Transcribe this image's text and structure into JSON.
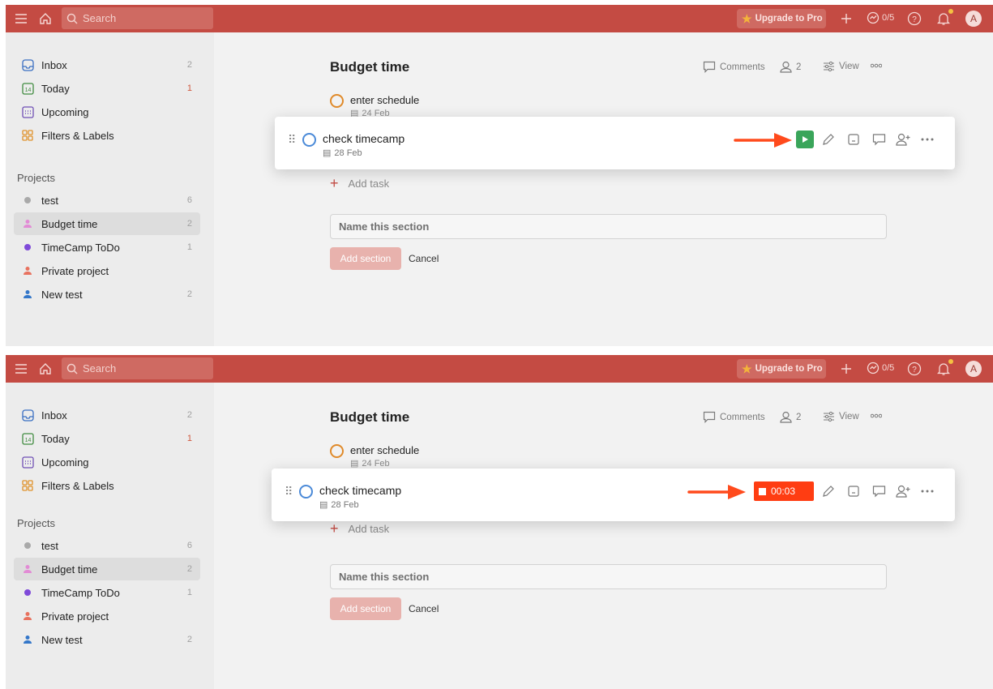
{
  "topbar": {
    "search_placeholder": "Search",
    "upgrade_label": "Upgrade to Pro",
    "karma": "0/5",
    "avatar_initial": "A"
  },
  "sidebar": {
    "items": [
      {
        "label": "Inbox",
        "count": "2"
      },
      {
        "label": "Today",
        "count": "1",
        "today_day": "14"
      },
      {
        "label": "Upcoming",
        "count": ""
      },
      {
        "label": "Filters & Labels",
        "count": ""
      }
    ],
    "projects_title": "Projects",
    "projects": [
      {
        "label": "test",
        "count": "6",
        "color": "#a9a9a9"
      },
      {
        "label": "Budget time",
        "count": "2",
        "color": "#e28bd5"
      },
      {
        "label": "TimeCamp ToDo",
        "count": "1",
        "color": "#7f4ad9"
      },
      {
        "label": "Private project",
        "count": "",
        "color": "#e8725f"
      },
      {
        "label": "New test",
        "count": "2",
        "color": "#3477c9"
      }
    ]
  },
  "main": {
    "title": "Budget time",
    "comments_label": "Comments",
    "members_count": "2",
    "view_label": "View",
    "tasks": [
      {
        "name": "enter schedule",
        "date": "24 Feb"
      },
      {
        "name": "check timecamp",
        "date": "28 Feb"
      }
    ],
    "add_task_label": "Add task",
    "section_placeholder": "Name this section",
    "add_section_label": "Add section",
    "cancel_label": "Cancel"
  },
  "timer": {
    "elapsed": "00:03"
  },
  "colors": {
    "topbar": "#c44b43",
    "play_green": "#3aa55a",
    "timer_red": "#ff3d12",
    "arrow": "#ff4a1c"
  }
}
